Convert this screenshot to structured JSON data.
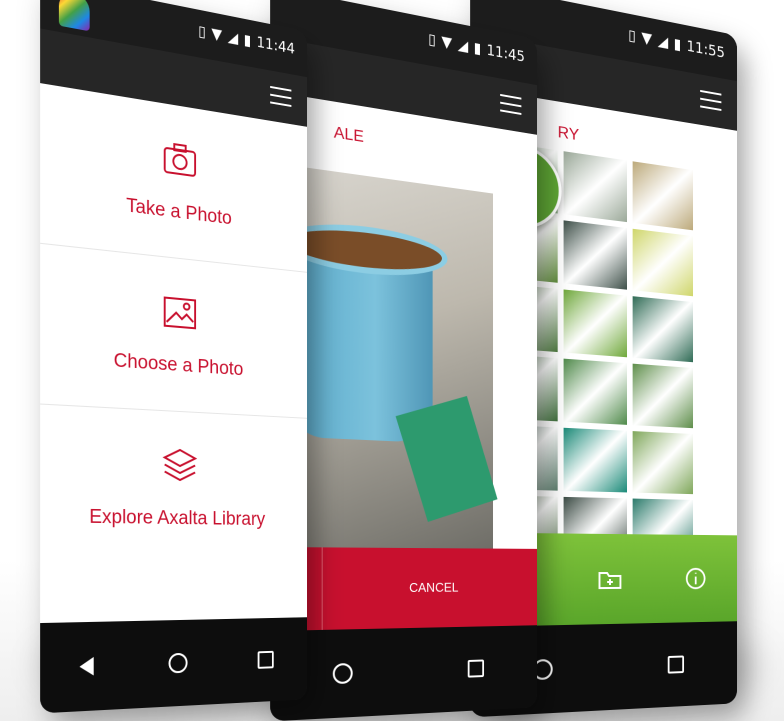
{
  "phone1": {
    "time": "11:44",
    "menu": [
      {
        "label": "Take a Photo",
        "icon": "camera-icon"
      },
      {
        "label": "Choose a Photo",
        "icon": "image-icon"
      },
      {
        "label": "Explore Axalta Library",
        "icon": "layers-icon"
      }
    ]
  },
  "phone2": {
    "time": "11:45",
    "title_fragment": "ALE",
    "cancel_label": "CANCEL"
  },
  "phone3": {
    "time": "11:55",
    "title_fragment": "RY",
    "swatches": [
      "#8fb38a",
      "#9aa898",
      "#bca97a",
      "#5f8c3a",
      "#3d4f48",
      "#cfd66a",
      "#4d7a3f",
      "#6fa83a",
      "#2f6b55",
      "#3e6f3a",
      "#4f8a4a",
      "#5e8e4a",
      "#5d7f6e",
      "#1a8a78",
      "#7fa75a",
      "#4d6b45",
      "#3a4a43",
      "#2a7a6a",
      "#3d5a55",
      "#2f4b4f",
      "#d4a43a"
    ],
    "lens_color": "#5ea634",
    "brand_red": "#c8102e"
  }
}
